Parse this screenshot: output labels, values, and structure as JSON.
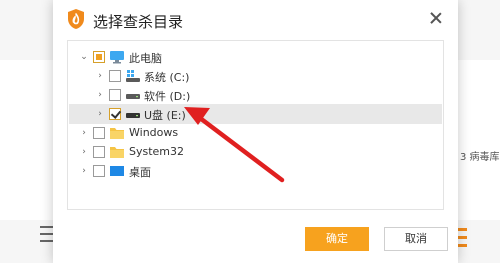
{
  "dialog": {
    "title": "选择查杀目录",
    "tree": [
      {
        "label": "此电脑",
        "icon": "computer-icon",
        "check": "partial",
        "expanded": true
      },
      {
        "label": "系统 (C:)",
        "icon": "system-drive-icon",
        "check": "unchecked",
        "expanded": false
      },
      {
        "label": "软件 (D:)",
        "icon": "drive-icon",
        "check": "unchecked",
        "expanded": false
      },
      {
        "label": "U盘 (E:)",
        "icon": "usb-drive-icon",
        "check": "checked",
        "expanded": false,
        "selected": true
      },
      {
        "label": "Windows",
        "icon": "folder-icon",
        "check": "unchecked",
        "expanded": false
      },
      {
        "label": "System32",
        "icon": "folder-icon",
        "check": "unchecked",
        "expanded": false
      },
      {
        "label": "桌面",
        "icon": "desktop-icon",
        "check": "unchecked",
        "expanded": false
      }
    ],
    "ok_label": "确定",
    "cancel_label": "取消"
  },
  "background": {
    "snippet": "3 病毒库"
  },
  "colors": {
    "accent": "#f7a21e",
    "annotation_arrow": "#e02020"
  }
}
